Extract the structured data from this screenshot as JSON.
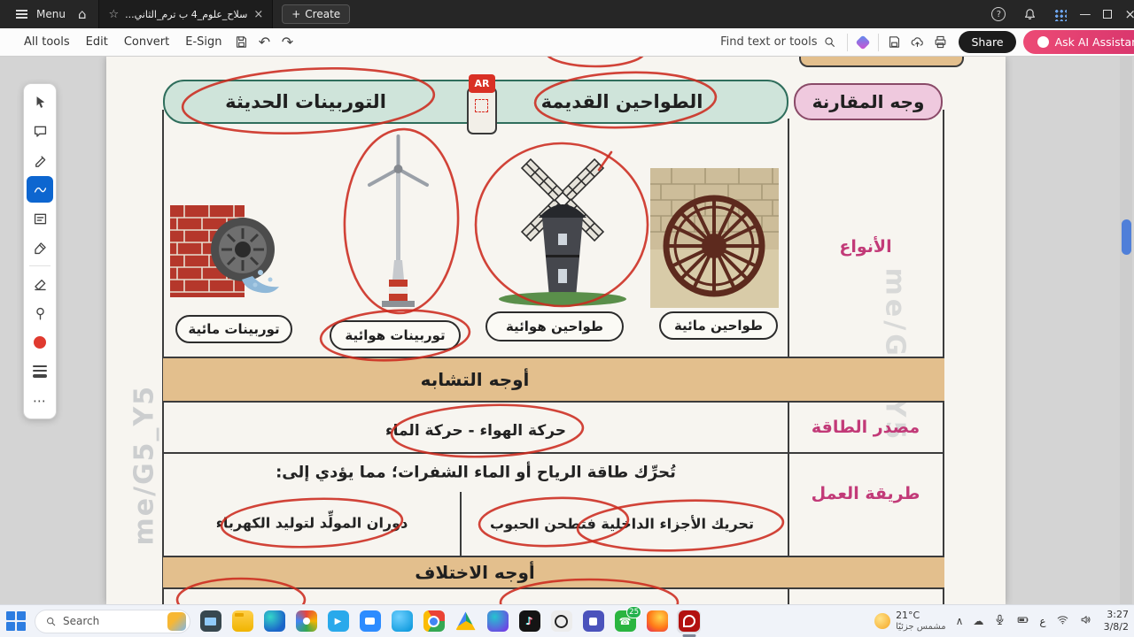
{
  "colors": {
    "header_teal_fill": "#cfe4da",
    "header_teal_border": "#2f6e5c",
    "compare_pink_fill": "#efc9de",
    "band_tan": "#e3bf8d",
    "label_pink": "#c23a78",
    "annotation_red": "#cc2a1e",
    "ai_button_pink": "#d6336c",
    "selected_tool_blue": "#0d66d0"
  },
  "app_bar": {
    "menu_label": "Menu",
    "tab_title": "سلاح_علوم_4 ب ترم_الثاني...",
    "create_label": "Create"
  },
  "toolbar": {
    "items": [
      "All tools",
      "Edit",
      "Convert",
      "E-Sign"
    ],
    "find_label": "Find text or tools",
    "share_label": "Share",
    "ai_assistant_label": "Ask AI Assistant"
  },
  "document": {
    "header_modern": "التوربينات الحديثة",
    "header_old": "الطواحين القديمة",
    "header_compare": "وجه المقارنة",
    "ar_badge": "AR",
    "types_label": "الأنواع",
    "captions": [
      "توربينات مائية",
      "توربينات هوائية",
      "طواحين هوائية",
      "طواحين مائية"
    ],
    "similarities_title": "أوجه التشابه",
    "energy_label": "مصدر الطاقة",
    "energy_value": "حركة الهواء - حركة الماء",
    "method_label": "طريقة العمل",
    "method_intro": "تُحرِّك طاقة الرياح أو الماء الشفرات؛ مما يؤدي إلى:",
    "method_modern": "دوران المولِّد لتوليد الكهرباء",
    "method_old": "تحريك الأجزاء الداخلية فتطحن الحبوب",
    "differences_title": "أوجه الاختلاف",
    "watermark_left": "me/G5_Y5",
    "watermark_right": "me/G5_Y5"
  },
  "icons": {
    "home": "⌂",
    "star": "☆",
    "close": "×",
    "plus": "+",
    "undo": "↶",
    "redo": "↷",
    "help": "?",
    "minimize": "—",
    "ellipsis": "⋯",
    "chevron_up": "∧",
    "cloud": "☁",
    "phone": "☎",
    "note": "♪",
    "send": "▶"
  },
  "taskbar": {
    "search_label": "Search",
    "whatsapp_badge": "25",
    "weather_temp": "21°C",
    "weather_desc": "مشمس جزئيًا",
    "lang": "ع",
    "time": "3:27",
    "date": "3/8/2"
  }
}
